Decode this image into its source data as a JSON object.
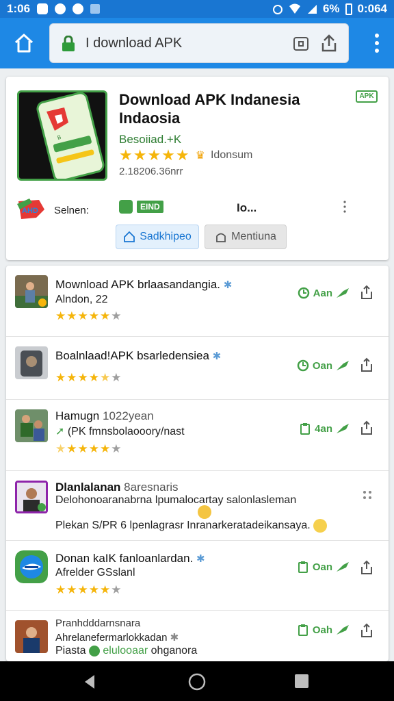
{
  "status_bar": {
    "time": "1:06",
    "battery": "6%",
    "clock_right": "0:064"
  },
  "browser": {
    "url": "I download APK"
  },
  "app_card": {
    "title": "Download APK Indanesia Indaosia",
    "badge": "APK",
    "developer": "Besoiiad.+K",
    "rating_stars": 5,
    "rating_count": "Idonsum",
    "downloads": "2.18206.36nrr",
    "select_label": "Selnen:",
    "chip_tag": "EIND",
    "version": "Io...",
    "primary_button": "Sadkhipeo",
    "secondary_button": "Mentiuna"
  },
  "list_items": [
    {
      "title": "Mownload APK brlaasandangia.",
      "subtitle": "Alndon, 22",
      "rating": 5,
      "action": "Aan"
    },
    {
      "title": "Boalnlaad!APK bsarledensiea",
      "rating": 4,
      "action": "Oan"
    },
    {
      "title": "Hamugn",
      "title_suffix": "1022yean",
      "subtitle": "(PK fmnsbolaooory/nast",
      "rating": 4,
      "action": "4an"
    },
    {
      "title": "Dlanlalanan",
      "title_suffix": "8aresnaris",
      "line2": "Delohonoaranabrna lpumalocartay salonlasleman",
      "line3": "Plekan S/PR 6 lpenlagrasr Inranarkeratadeikansaya."
    },
    {
      "title": "Donan kaIK fanloanlardan.",
      "subtitle": "Afrelder GSslanl",
      "rating": 5,
      "action": "Oan"
    },
    {
      "title": "Pranhdddarnsnara",
      "subtitle": "Ahrelanefermarlokkadan",
      "line3_prefix": "Piasta",
      "line3_green": "elulooaar",
      "line3_suffix": "ohganora",
      "action": "Oah"
    }
  ],
  "colors": {
    "primary_blue": "#1e88e5",
    "green": "#43a047",
    "star_yellow": "#f5b50b"
  }
}
